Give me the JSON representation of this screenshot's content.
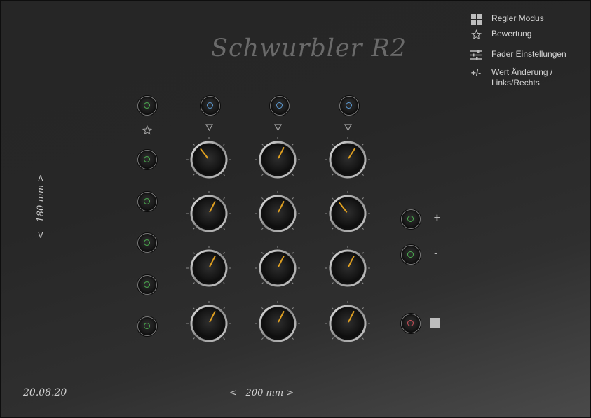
{
  "title": "Schwurbler R2",
  "legend": [
    {
      "icon": "grid-icon",
      "label": "Regler Modus"
    },
    {
      "icon": "star-icon",
      "label": "Bewertung"
    },
    {
      "icon": "sliders-icon",
      "label": "Fader Einstellungen"
    },
    {
      "icon": "plus-minus-icon",
      "glyph": "+/-",
      "label": "Wert Änderung /",
      "label2": "Links/Rechts"
    }
  ],
  "left_jacks": {
    "top_led_color": "#4caf50",
    "led_color": "#4caf50"
  },
  "top_jacks": {
    "led_color": "#5b9bd5"
  },
  "knob_indicator_color": "#e0a020",
  "knob_values": [
    [
      0.36,
      0.6,
      0.62
    ],
    [
      0.6,
      0.6,
      0.36
    ],
    [
      0.6,
      0.6,
      0.6
    ],
    [
      0.6,
      0.6,
      0.6
    ]
  ],
  "right_controls": {
    "plus_label": "+",
    "minus_label": "-",
    "plus_led": "#4caf50",
    "minus_led": "#4caf50",
    "mode_led": "#d0505a"
  },
  "dimensions": {
    "height_label": "<  - 180 mm  >",
    "width_label": "<  - 200 mm  >"
  },
  "date": "20.08.20"
}
